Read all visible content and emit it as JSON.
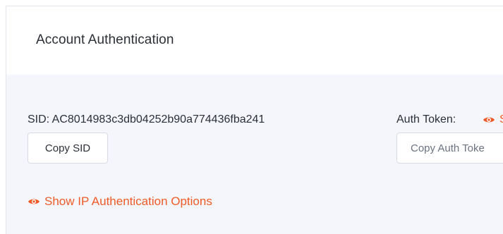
{
  "header": {
    "title": "Account Authentication"
  },
  "credentials": {
    "sid_text": "SID: AC8014983c3db04252b90a774436fba241",
    "copy_sid_label": "Copy SID",
    "auth_token_label": "Auth Token:",
    "auth_token_show_label": "S",
    "copy_auth_token_label": "Copy Auth Toke"
  },
  "ip_options": {
    "link_label": "Show IP Authentication Options"
  },
  "icons": {
    "show_token": "eye-icon",
    "ip_options": "eye-icon"
  },
  "colors": {
    "accent": "#f05a28",
    "panel_background": "#f4f6fb",
    "text": "#2b2f36"
  }
}
